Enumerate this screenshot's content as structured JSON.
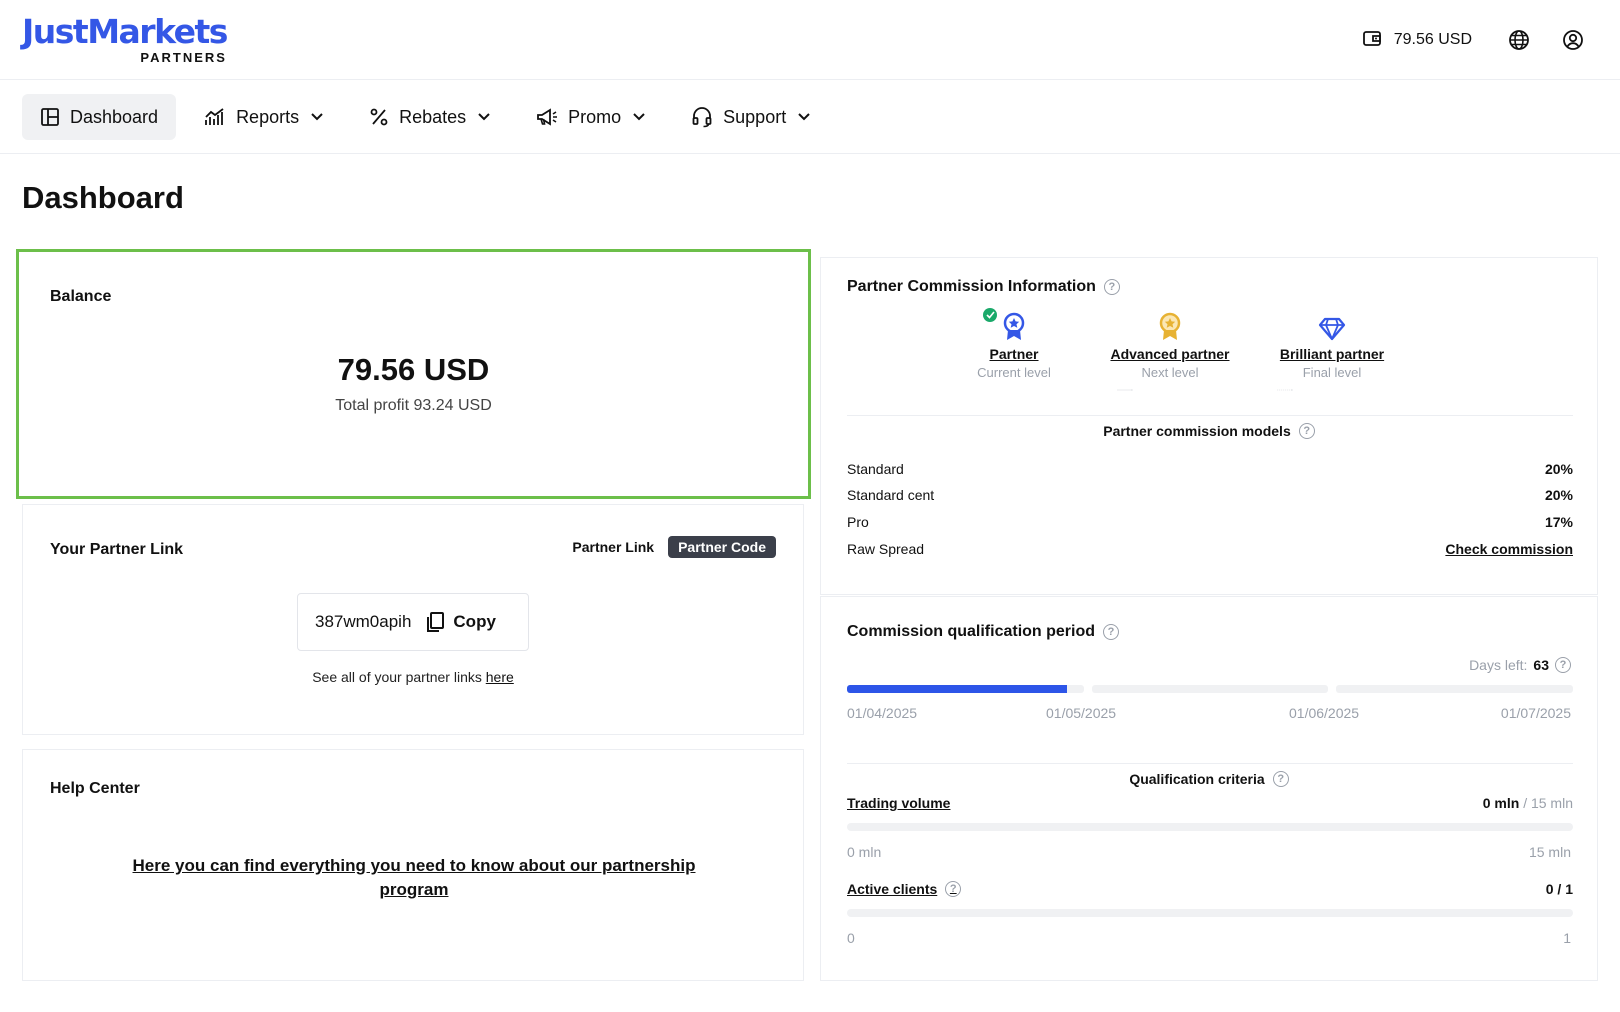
{
  "header": {
    "logo_main": "JustMarkets",
    "logo_sub": "PARTNERS",
    "wallet_balance": "79.56 USD"
  },
  "nav": {
    "dashboard": "Dashboard",
    "reports": "Reports",
    "rebates": "Rebates",
    "promo": "Promo",
    "support": "Support"
  },
  "page": {
    "title": "Dashboard"
  },
  "balance": {
    "title": "Balance",
    "amount": "79.56 USD",
    "total_profit": "Total profit 93.24 USD"
  },
  "partner_link": {
    "title": "Your Partner Link",
    "toggle_link": "Partner Link",
    "toggle_code": "Partner Code",
    "code": "387wm0apih",
    "copy_label": "Copy",
    "see_all_prefix": "See all of your partner links",
    "see_all_link": "here"
  },
  "help": {
    "title": "Help Center",
    "link_text": "Here you can find everything you need to know about our partnership program"
  },
  "commission": {
    "title": "Partner Commission Information",
    "levels": [
      {
        "name": "Partner",
        "sub": "Current level",
        "color": "#3457e6"
      },
      {
        "name": "Advanced partner",
        "sub": "Next level",
        "color": "#e7b233"
      },
      {
        "name": "Brilliant partner",
        "sub": "Final level",
        "color": "#3457e6"
      }
    ],
    "models_title": "Partner commission models",
    "models": [
      {
        "name": "Standard",
        "value": "20%"
      },
      {
        "name": "Standard cent",
        "value": "20%"
      },
      {
        "name": "Pro",
        "value": "17%"
      },
      {
        "name": "Raw Spread",
        "value": "Check commission"
      }
    ]
  },
  "qualification": {
    "title": "Commission qualification period",
    "days_left_label": "Days left:",
    "days_left_value": "63",
    "progress_fraction": 0.31,
    "dates": [
      "01/04/2025",
      "01/05/2025",
      "01/06/2025",
      "01/07/2025"
    ],
    "criteria_title": "Qualification criteria",
    "trading_volume": {
      "label": "Trading volume",
      "current": "0 mln",
      "target": "/ 15 mln",
      "min_label": "0 mln",
      "max_label": "15 mln",
      "fraction": 0
    },
    "active_clients": {
      "label": "Active clients",
      "current": "0 / 1",
      "min_label": "0",
      "max_label": "1",
      "fraction": 0
    }
  },
  "colors": {
    "brand": "#3457e6",
    "highlight_border": "#6cbf4a",
    "progress": "#2d55e8",
    "success": "#1aa96a"
  }
}
